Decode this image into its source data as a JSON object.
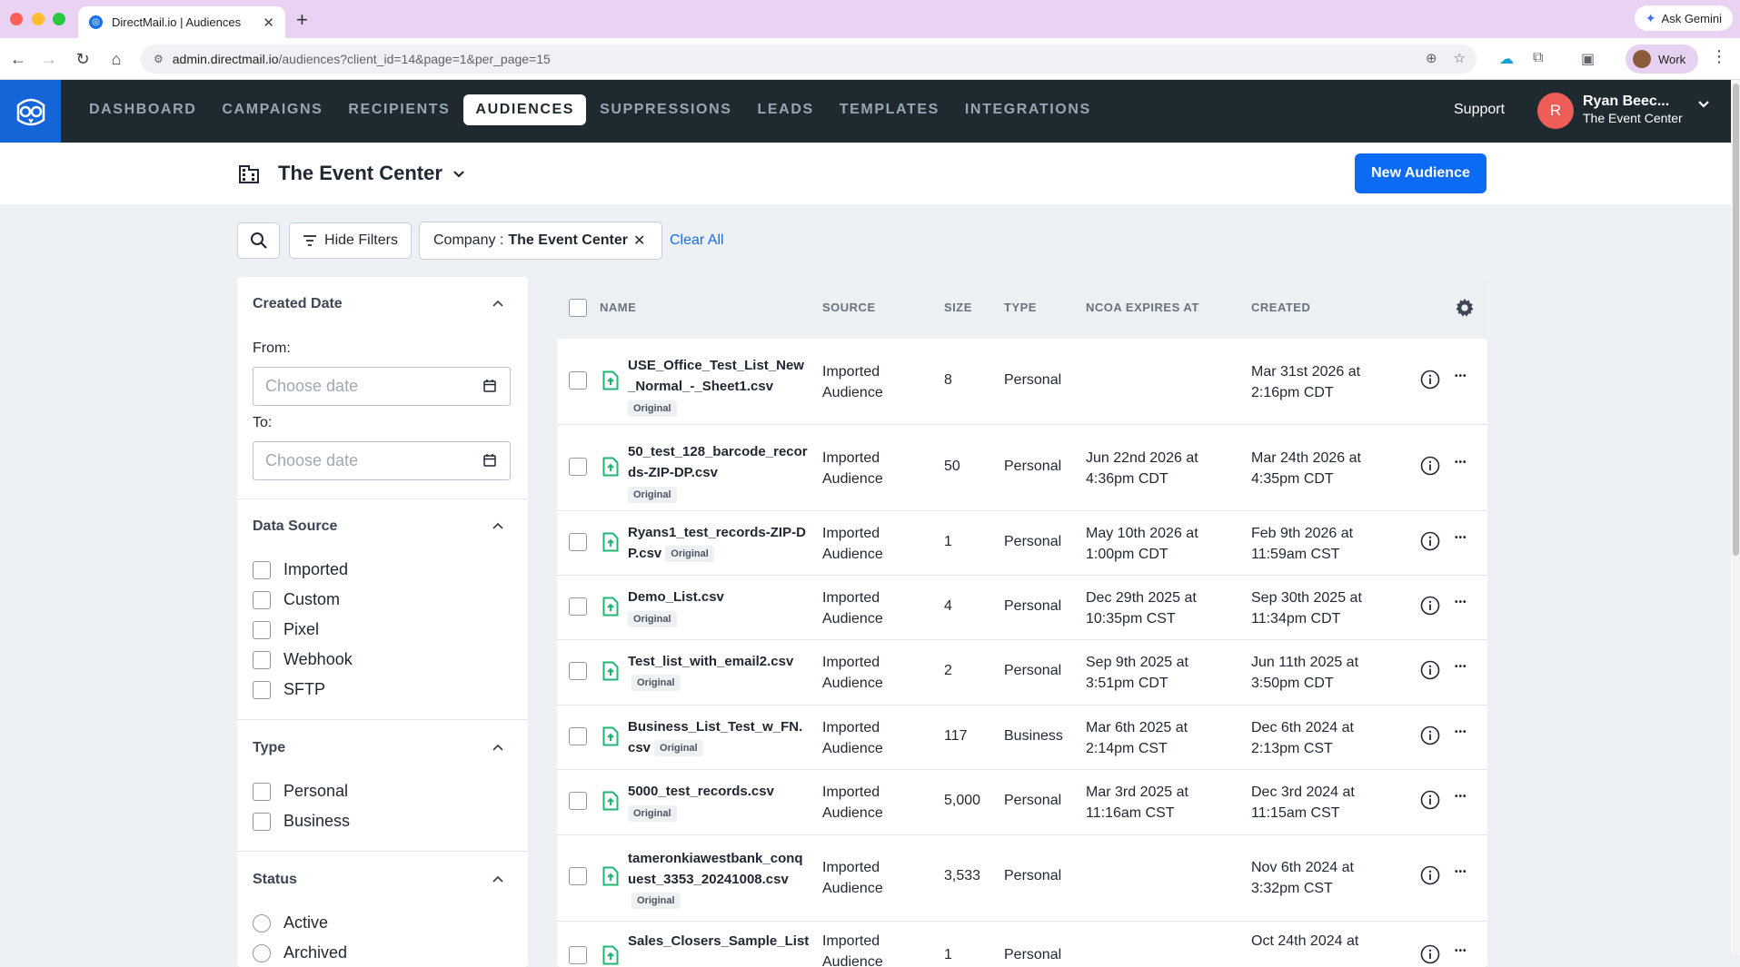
{
  "browser": {
    "tab_title": "DirectMail.io | Audiences",
    "url_host": "admin.directmail.io",
    "url_rest": "/audiences?client_id=14&page=1&per_page=15",
    "ask_gemini": "Ask Gemini",
    "profile": "Work"
  },
  "header": {
    "nav": [
      "DASHBOARD",
      "CAMPAIGNS",
      "RECIPIENTS",
      "AUDIENCES",
      "SUPPRESSIONS",
      "LEADS",
      "TEMPLATES",
      "INTEGRATIONS"
    ],
    "active": "AUDIENCES",
    "support": "Support",
    "user_initial": "R",
    "user_name": "Ryan Beec...",
    "user_company": "The Event Center"
  },
  "sub_header": {
    "company": "The Event Center",
    "new_audience": "New Audience"
  },
  "filter_bar": {
    "hide_filters": "Hide Filters",
    "chip_label": "Company :",
    "chip_value": "The Event Center",
    "clear_all": "Clear All"
  },
  "filters": {
    "created_date": {
      "title": "Created Date",
      "from_label": "From:",
      "to_label": "To:",
      "placeholder": "Choose date"
    },
    "data_source": {
      "title": "Data Source",
      "options": [
        "Imported",
        "Custom",
        "Pixel",
        "Webhook",
        "SFTP"
      ]
    },
    "type": {
      "title": "Type",
      "options": [
        "Personal",
        "Business"
      ]
    },
    "status": {
      "title": "Status",
      "options": [
        "Active",
        "Archived"
      ]
    }
  },
  "table": {
    "columns": [
      "NAME",
      "SOURCE",
      "SIZE",
      "TYPE",
      "NCOA EXPIRES AT",
      "CREATED"
    ],
    "badge": "Original",
    "rows": [
      {
        "name": "USE_Office_Test_List_New_Normal_-_Sheet1.csv",
        "source": "Imported Audience",
        "size": "8",
        "type": "Personal",
        "ncoa": "",
        "created": "Mar 31st 2026 at 2:16pm CDT"
      },
      {
        "name": "50_test_128_barcode_records-ZIP-DP.csv",
        "source": "Imported Audience",
        "size": "50",
        "type": "Personal",
        "ncoa": "Jun 22nd 2026 at 4:36pm CDT",
        "created": "Mar 24th 2026 at 4:35pm CDT"
      },
      {
        "name": "Ryans1_test_records-ZIP-DP.csv",
        "source": "Imported Audience",
        "size": "1",
        "type": "Personal",
        "ncoa": "May 10th 2026 at 1:00pm CDT",
        "created": "Feb 9th 2026 at 11:59am CST"
      },
      {
        "name": "Demo_List.csv",
        "source": "Imported Audience",
        "size": "4",
        "type": "Personal",
        "ncoa": "Dec 29th 2025 at 10:35pm CST",
        "created": "Sep 30th 2025 at 11:34pm CDT"
      },
      {
        "name": "Test_list_with_email2.csv",
        "source": "Imported Audience",
        "size": "2",
        "type": "Personal",
        "ncoa": "Sep 9th 2025 at 3:51pm CDT",
        "created": "Jun 11th 2025 at 3:50pm CDT"
      },
      {
        "name": "Business_List_Test_w_FN.csv",
        "source": "Imported Audience",
        "size": "117",
        "type": "Business",
        "ncoa": "Mar 6th 2025 at 2:14pm CST",
        "created": "Dec 6th 2024 at 2:13pm CST"
      },
      {
        "name": "5000_test_records.csv",
        "source": "Imported Audience",
        "size": "5,000",
        "type": "Personal",
        "ncoa": "Mar 3rd 2025 at 11:16am CST",
        "created": "Dec 3rd 2024 at 11:15am CST"
      },
      {
        "name": "tameronkiawestbank_conquest_3353_20241008.csv",
        "source": "Imported Audience",
        "size": "3,533",
        "type": "Personal",
        "ncoa": "",
        "created": "Nov 6th 2024 at 3:32pm CST"
      },
      {
        "name": "Sales_Closers_Sample_List",
        "source": "Imported Audience",
        "size": "1",
        "type": "Personal",
        "ncoa": "",
        "created": "Oct 24th 2024 at"
      }
    ]
  },
  "colors": {
    "header_bg": "#1f2a30",
    "brand_blue": "#0b6bf5",
    "logo_bg": "#1665d8",
    "avatar": "#ef5d58",
    "file_icon": "#22b573"
  }
}
